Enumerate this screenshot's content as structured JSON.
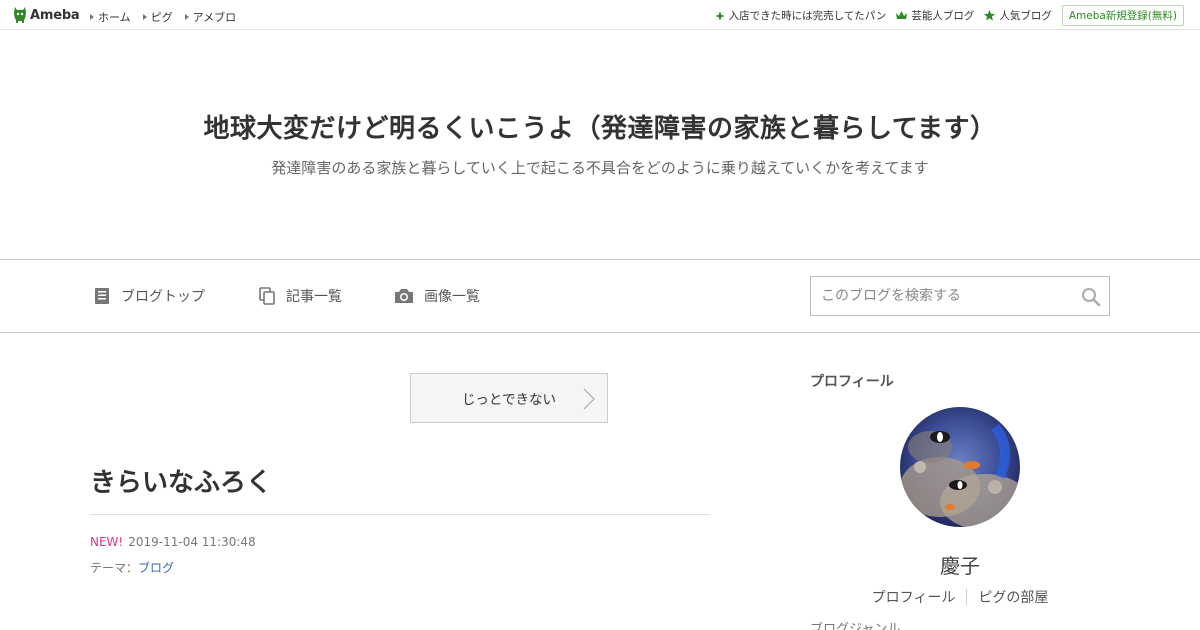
{
  "topbar": {
    "logo_text": "Ameba",
    "nav": [
      "ホーム",
      "ピグ",
      "アメブロ"
    ],
    "links": [
      {
        "label": "入店できた時には完売してたパン",
        "icon": "sparkle-icon"
      },
      {
        "label": "芸能人ブログ",
        "icon": "crown-icon"
      },
      {
        "label": "人気ブログ",
        "icon": "star-icon"
      }
    ],
    "register_label": "Ameba新規登録(無料)"
  },
  "header": {
    "title": "地球大変だけど明るくいこうよ（発達障害の家族と暮らしてます）",
    "description": "発達障害のある家族と暮らしていく上で起こる不具合をどのように乗り越えていくかを考えてます"
  },
  "nav": {
    "blog_top": "ブログトップ",
    "articles": "記事一覧",
    "images": "画像一覧",
    "search_placeholder": "このブログを検索する"
  },
  "main": {
    "pager_label": "じっとできない",
    "entry_title": "きらいなふろく",
    "new_badge": "NEW!",
    "timestamp": "2019-11-04 11:30:48",
    "theme_label": "テーマ：",
    "theme_value": "ブログ"
  },
  "sidebar": {
    "profile_heading": "プロフィール",
    "name": "慶子",
    "profile_link": "プロフィール",
    "pigg_link": "ピグの部屋",
    "next_heading": "ブログジャンル"
  },
  "colors": {
    "accent_green": "#2f8a25",
    "new_pink": "#e0368c",
    "link_blue": "#3366b8"
  }
}
